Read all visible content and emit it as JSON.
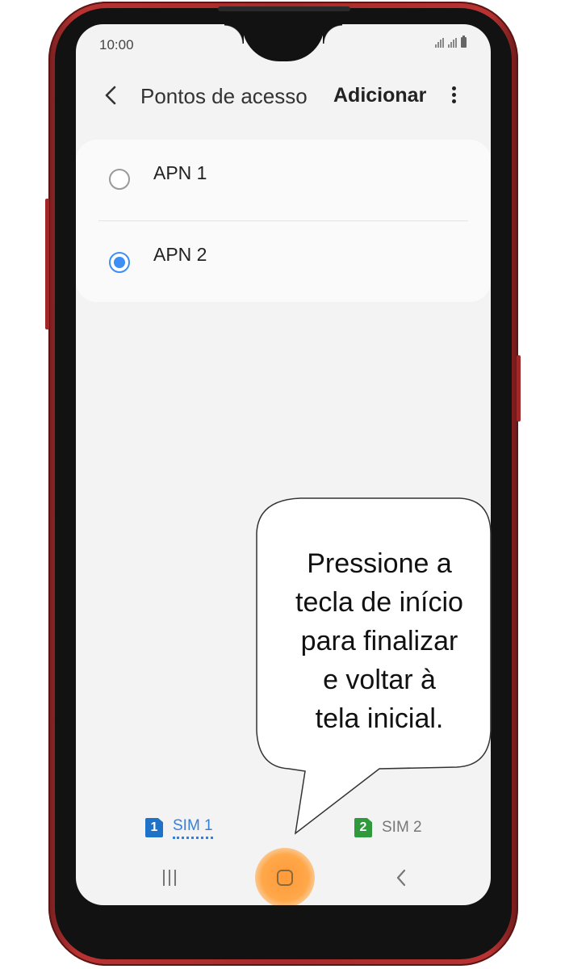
{
  "status_bar": {
    "time": "10:00"
  },
  "header": {
    "title": "Pontos de acesso",
    "add_label": "Adicionar"
  },
  "apn_list": [
    {
      "label": "APN 1",
      "selected": false
    },
    {
      "label": "APN 2",
      "selected": true
    }
  ],
  "sim_tabs": [
    {
      "badge": "1",
      "label": "SIM 1",
      "active": true
    },
    {
      "badge": "2",
      "label": "SIM 2",
      "active": false
    }
  ],
  "bubble": {
    "lines": [
      "Pressione a",
      "tecla de início",
      "para finalizar",
      "e voltar à",
      "tela inicial."
    ]
  },
  "colors": {
    "accent": "#3e8ef7",
    "phone_body": "#a82a2a",
    "highlight": "#ff9a3a",
    "sim1": "#1e73c8",
    "sim2": "#2e9a3c"
  }
}
